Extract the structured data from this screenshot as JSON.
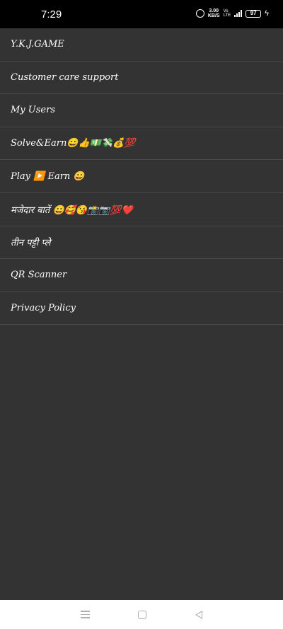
{
  "status_bar": {
    "time": "7:29",
    "net_speed_value": "3.00",
    "net_speed_unit": "KB/S",
    "sim_top": "Vo",
    "sim_bottom": "LTE",
    "network": "4G",
    "battery": "97"
  },
  "menu": {
    "items": [
      {
        "label": "Y.K.J.GAME"
      },
      {
        "label": "Customer care support"
      },
      {
        "label": "My Users"
      },
      {
        "label": "Solve&Earn😀👍💵💸💰💯"
      },
      {
        "label": "Play ▶️ Earn 😀"
      },
      {
        "label": "मजेदार बातें 😀🥰😘📸📷💯❤️"
      },
      {
        "label": "तीन पट्टी प्ले"
      },
      {
        "label": "QR Scanner"
      },
      {
        "label": "Privacy Policy"
      }
    ]
  },
  "nav_bar": {
    "icons": [
      "menu-lines-icon",
      "home-square-icon",
      "back-triangle-icon"
    ]
  }
}
